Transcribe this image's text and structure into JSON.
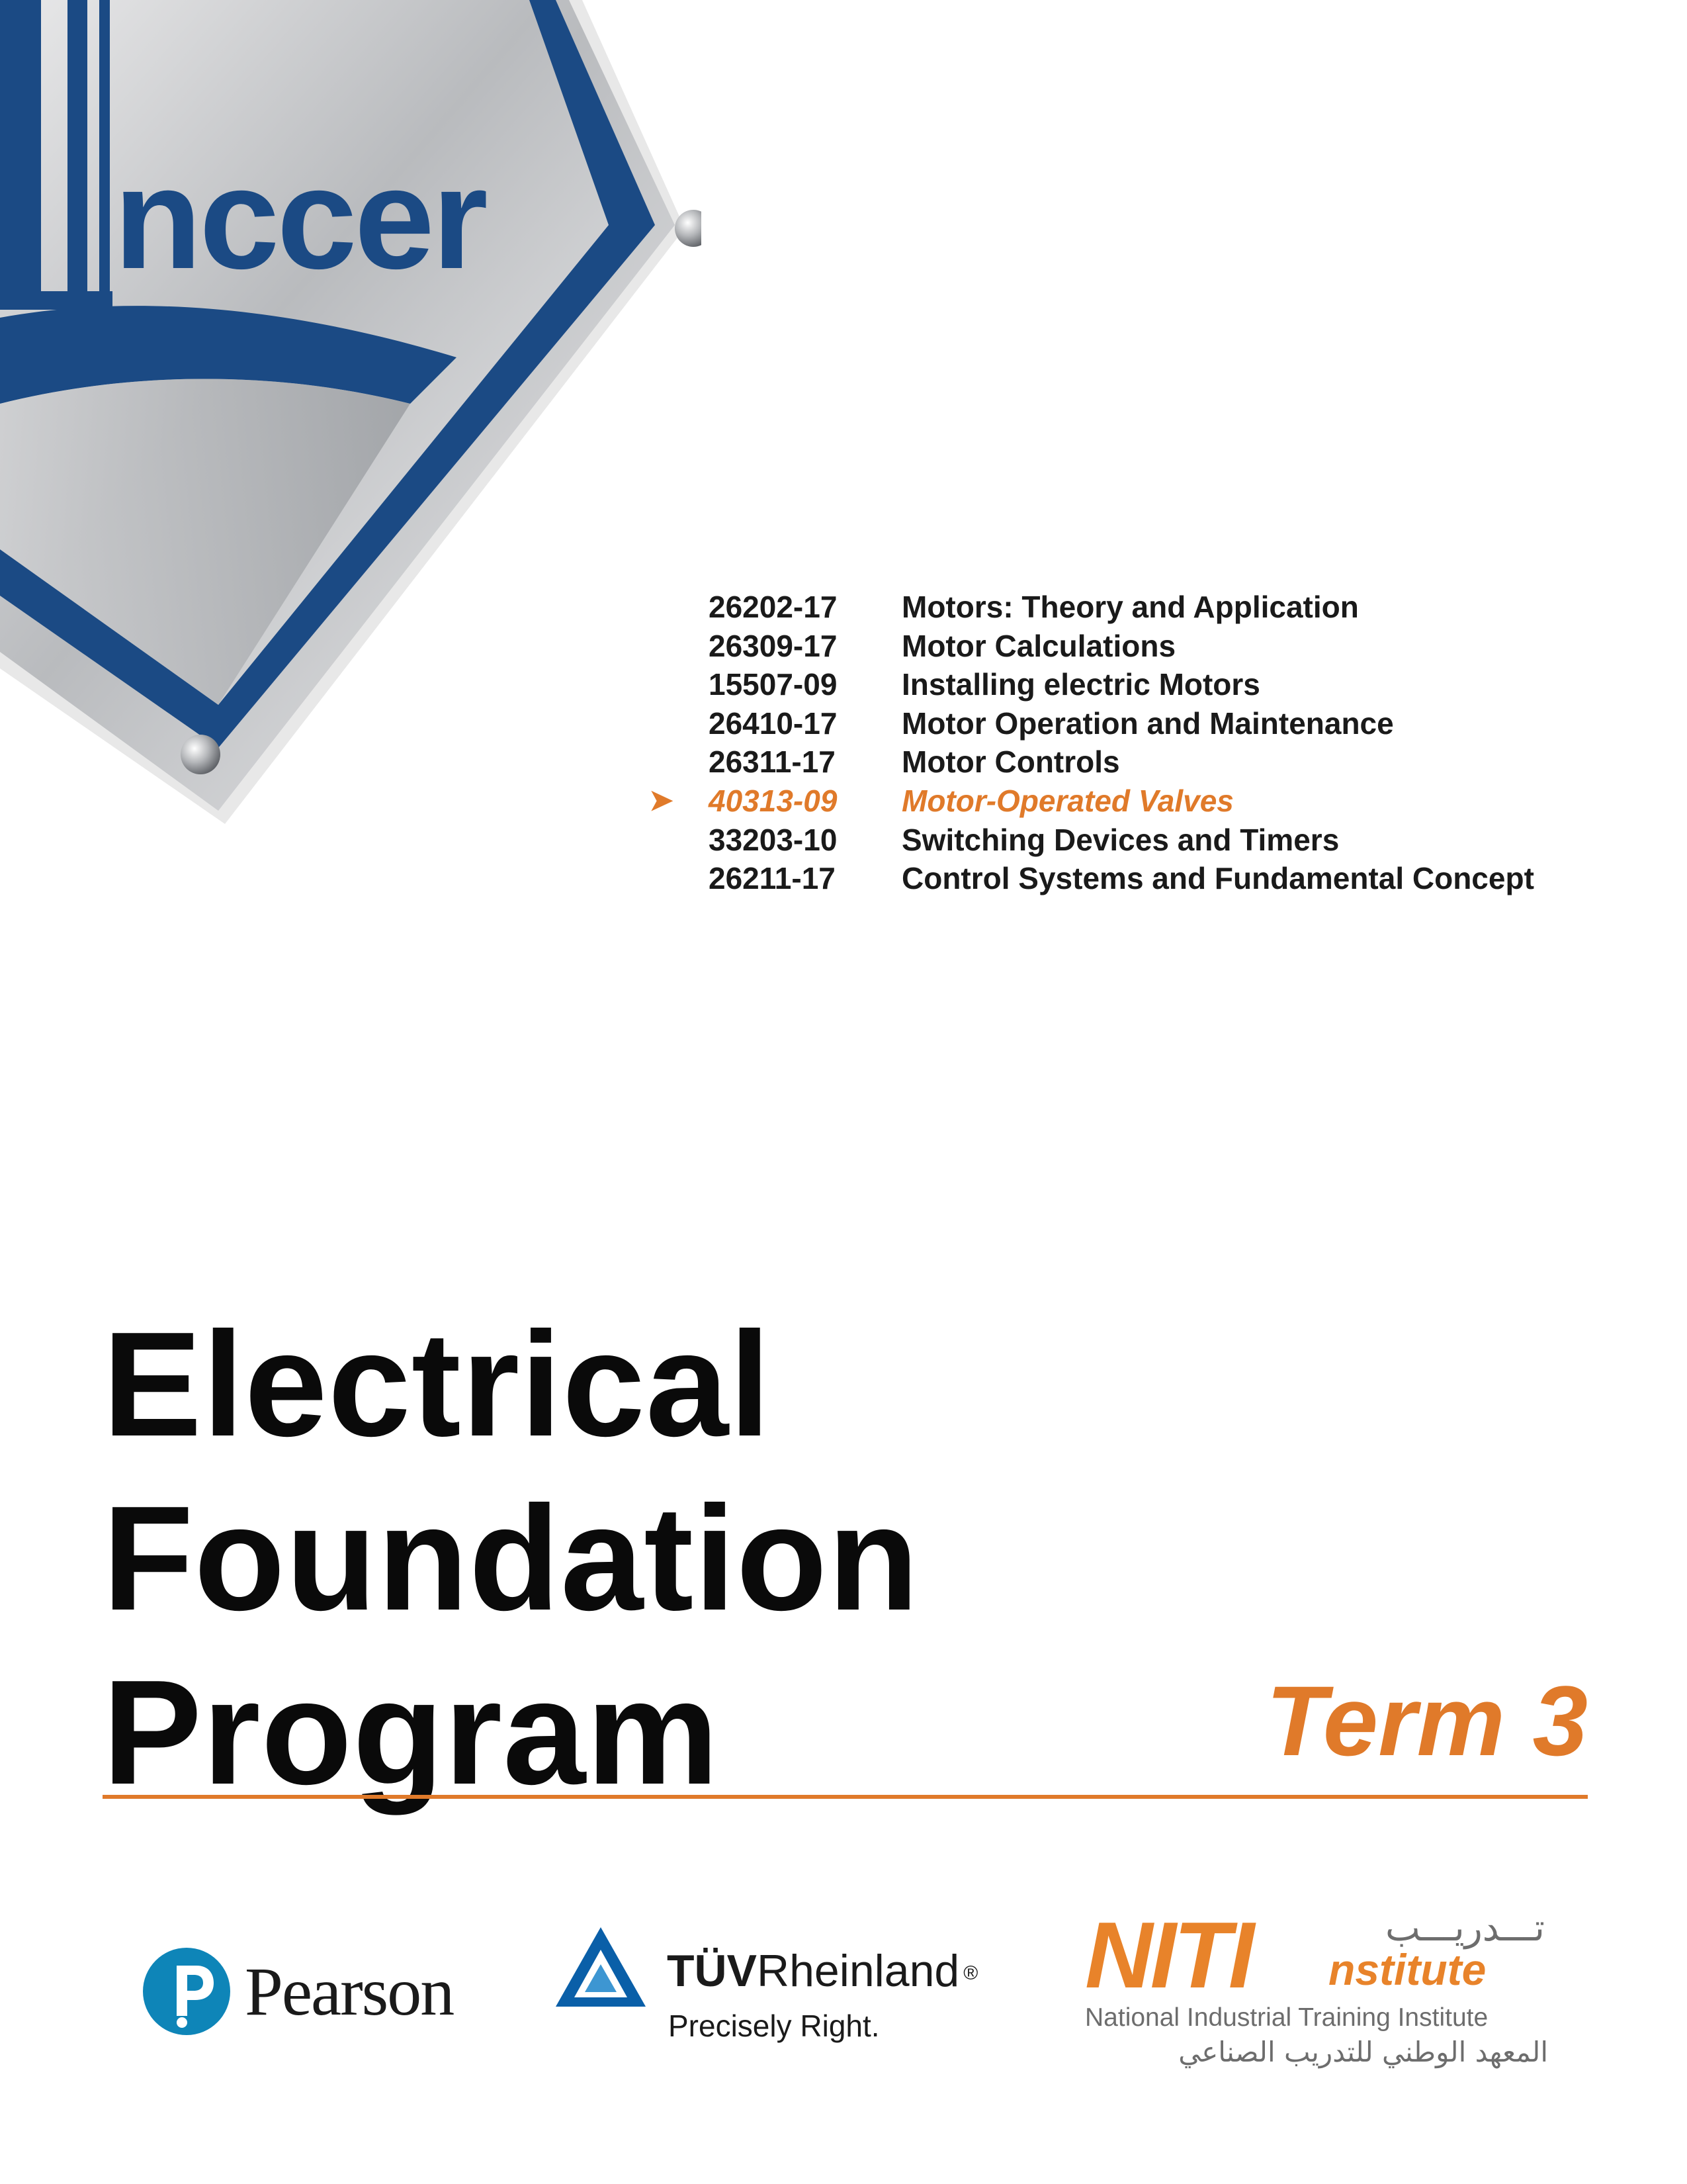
{
  "cover": {
    "logo_text": "nccer",
    "modules": [
      {
        "code": "26202-17",
        "title": "Motors: Theory and Application",
        "current": false
      },
      {
        "code": "26309-17",
        "title": "Motor Calculations",
        "current": false
      },
      {
        "code": "15507-09",
        "title": "Installing electric Motors",
        "current": false
      },
      {
        "code": "26410-17",
        "title": "Motor Operation and Maintenance",
        "current": false
      },
      {
        "code": "26311-17",
        "title": "Motor Controls",
        "current": false
      },
      {
        "code": "40313-09",
        "title": "Motor-Operated Valves",
        "current": true
      },
      {
        "code": "33203-10",
        "title": "Switching Devices and Timers",
        "current": false
      },
      {
        "code": "26211-17",
        "title": "Control Systems and Fundamental Concept",
        "current": false
      }
    ],
    "current_marker": "➤",
    "title_lines": [
      "Electrical",
      "Foundation",
      "Program"
    ],
    "term": "Term 3",
    "accent_color": "#e07a2a",
    "logo_blue": "#1b4a84"
  },
  "partners": {
    "pearson": {
      "name": "Pearson",
      "icon": "pearson-p-icon"
    },
    "tuv": {
      "name_bold": "TÜV",
      "name_regular": "Rheinland",
      "registered": "®",
      "tagline": "Precisely Right.",
      "icon": "tuv-triangle-icon"
    },
    "niti": {
      "short": "NITI",
      "arabic_short": "تـــدريـــب",
      "institute": "nstitute",
      "full_name": "National Industrial Training Institute",
      "arabic_full": "المعهد الوطني للتدريب الصناعي"
    }
  }
}
